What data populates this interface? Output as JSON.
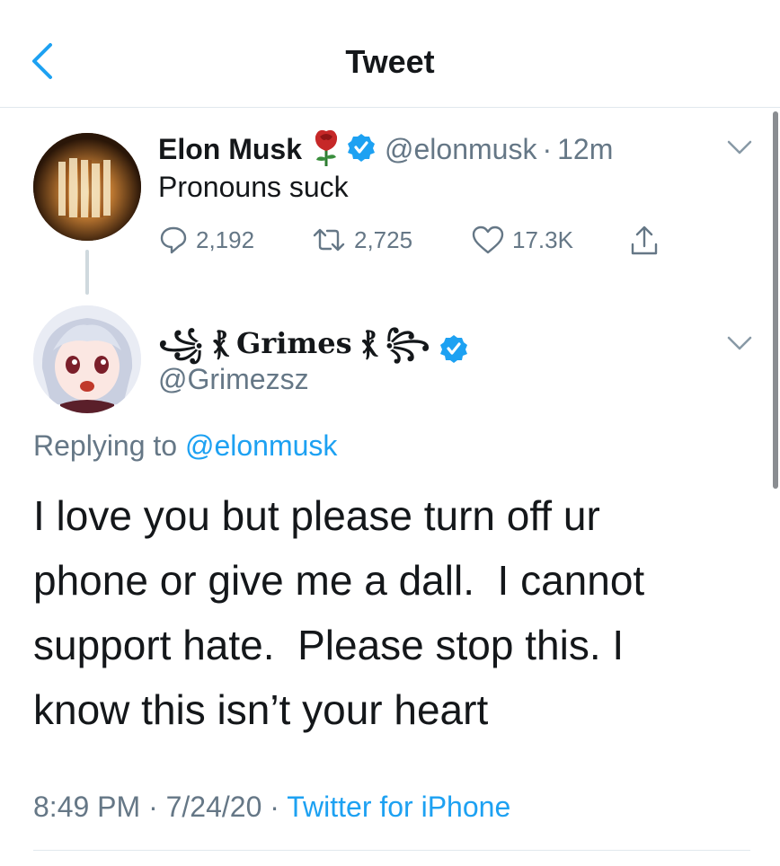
{
  "header": {
    "title": "Tweet"
  },
  "parent_tweet": {
    "name": "Elon Musk",
    "handle": "@elonmusk",
    "separator": "·",
    "age": "12m",
    "text": "Pronouns suck",
    "replies": "2,192",
    "retweets": "2,725",
    "likes": "17.3K",
    "emoji": "rose-emoji"
  },
  "reply_tweet": {
    "name": "꧁ ⳩ Grimes ⳩ ꧂",
    "handle": "@Grimezsz",
    "replying_prefix": "Replying to ",
    "replying_to": "@elonmusk",
    "lines": [
      "I love you but please turn off ur",
      "phone or give me a dall.  I cannot",
      "support hate.  Please stop this. I",
      "know this isn’t your heart"
    ],
    "time": "8:49 PM",
    "date": "7/24/20",
    "separator": "·",
    "source": "Twitter for iPhone"
  },
  "colors": {
    "accent": "#1da1f2",
    "text": "#14171a",
    "secondary": "#657786",
    "divider": "#e1e8ed"
  },
  "icons": [
    "back-chevron-icon",
    "rose-emoji",
    "verified-badge-icon",
    "caret-down-icon",
    "reply-icon",
    "retweet-icon",
    "like-icon",
    "share-icon"
  ]
}
